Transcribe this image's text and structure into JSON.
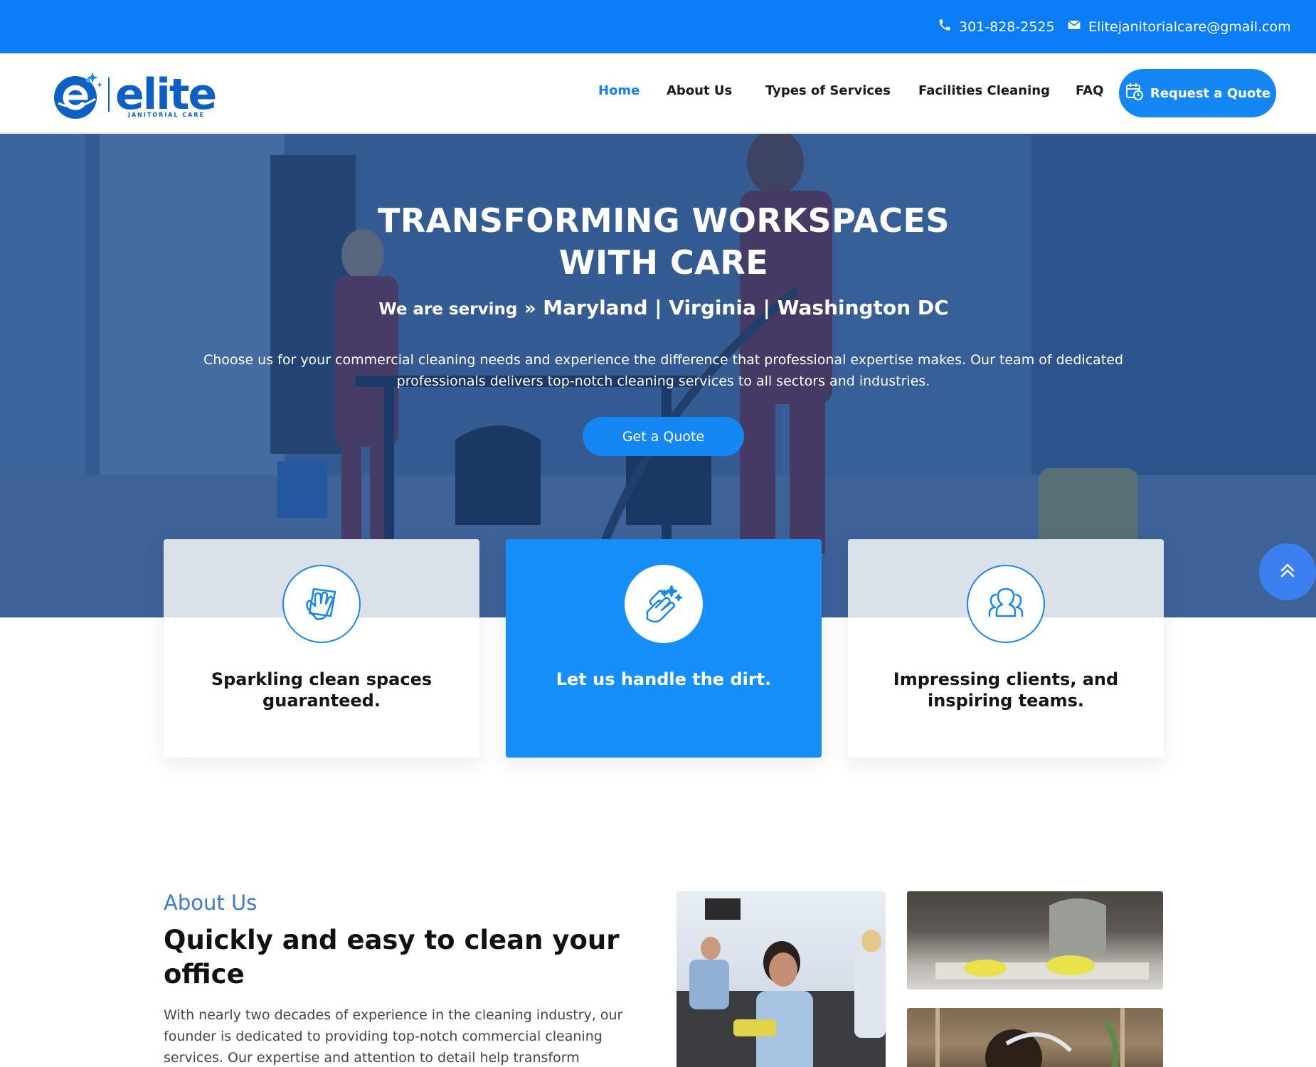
{
  "topbar": {
    "phone": "301-828-2525",
    "email": "Elitejanitorialcare@gmail.com",
    "phone_icon": "phone-icon",
    "email_icon": "envelope-icon",
    "background": "#0a7cf5"
  },
  "brand": {
    "name": "elite",
    "tagline": "JANITORIAL CARE",
    "color": "#0c5fc4"
  },
  "nav": {
    "items": [
      {
        "label": "Home",
        "active": true
      },
      {
        "label": "About Us",
        "active": false
      },
      {
        "label": "Types of Services",
        "active": false
      },
      {
        "label": "Facilities Cleaning",
        "active": false
      },
      {
        "label": "FAQ",
        "active": false
      }
    ],
    "cta_label": "Request a Quote",
    "cta_icon": "calendar-clock-icon",
    "accent": "#1487f5"
  },
  "hero": {
    "title_line1": "TRANSFORMING WORKSPACES",
    "title_line2": "WITH CARE",
    "serving_lead": "We are serving",
    "serving_arrow": "»",
    "regions": "Maryland | Virginia | Washington DC",
    "description": "Choose us for your commercial cleaning needs and experience the difference that professional expertise makes. Our team of dedicated professionals delivers top-notch cleaning services to all sectors and industries.",
    "cta_label": "Get a Quote"
  },
  "features": [
    {
      "title": "Sparkling clean spaces guaranteed.",
      "icon": "cleaning-cloth-hand-icon"
    },
    {
      "title": "Let us handle the dirt.",
      "icon": "sparkling-hands-icon"
    },
    {
      "title": "Impressing clients, and inspiring teams.",
      "icon": "team-people-icon"
    }
  ],
  "scroll_up_icon": "double-chevron-up-icon",
  "about": {
    "eyebrow": "About Us",
    "heading": "Quickly and easy to clean your office",
    "body": "With nearly two decades of experience in the cleaning industry, our founder is dedicated to providing top-notch commercial cleaning services. Our expertise and attention to detail help transform"
  }
}
